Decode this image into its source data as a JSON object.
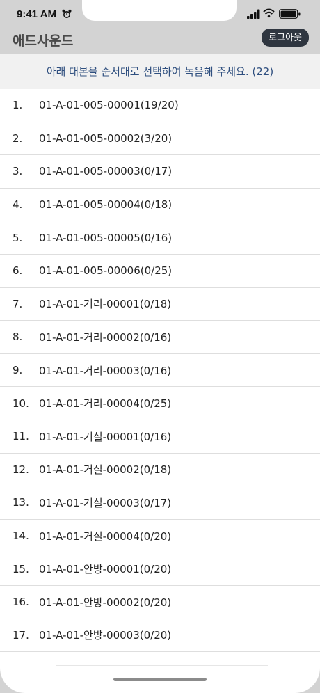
{
  "status_bar": {
    "time": "9:41 AM",
    "icons": [
      "alarm-clock-icon",
      "cellular-signal-icon",
      "wifi-icon",
      "battery-icon"
    ]
  },
  "header": {
    "title": "애드사운드",
    "logout_label": "로그아웃"
  },
  "instruction": "아래 대본을 순서대로 선택하여 녹음해 주세요. (22)",
  "list": [
    {
      "num": "1.",
      "label": "01-A-01-005-00001(19/20)"
    },
    {
      "num": "2.",
      "label": "01-A-01-005-00002(3/20)"
    },
    {
      "num": "3.",
      "label": "01-A-01-005-00003(0/17)"
    },
    {
      "num": "4.",
      "label": "01-A-01-005-00004(0/18)"
    },
    {
      "num": "5.",
      "label": "01-A-01-005-00005(0/16)"
    },
    {
      "num": "6.",
      "label": "01-A-01-005-00006(0/25)"
    },
    {
      "num": "7.",
      "label": "01-A-01-거리-00001(0/18)"
    },
    {
      "num": "8.",
      "label": "01-A-01-거리-00002(0/16)"
    },
    {
      "num": "9.",
      "label": "01-A-01-거리-00003(0/16)"
    },
    {
      "num": "10.",
      "label": "01-A-01-거리-00004(0/25)"
    },
    {
      "num": "11.",
      "label": "01-A-01-거실-00001(0/16)"
    },
    {
      "num": "12.",
      "label": "01-A-01-거실-00002(0/18)"
    },
    {
      "num": "13.",
      "label": "01-A-01-거실-00003(0/17)"
    },
    {
      "num": "14.",
      "label": "01-A-01-거실-00004(0/20)"
    },
    {
      "num": "15.",
      "label": "01-A-01-안방-00001(0/20)"
    },
    {
      "num": "16.",
      "label": "01-A-01-안방-00002(0/20)"
    },
    {
      "num": "17.",
      "label": "01-A-01-안방-00003(0/20)"
    }
  ],
  "colors": {
    "header_bg": "#d3d3d3",
    "logout_bg": "#2f3640",
    "instruction_bg": "#f1f1f1",
    "instruction_text": "#2f4f7f"
  }
}
